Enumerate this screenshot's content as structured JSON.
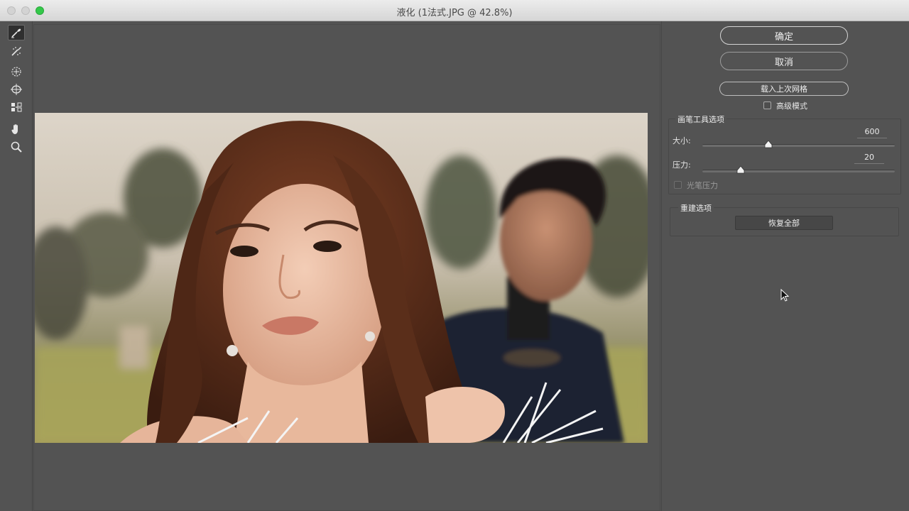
{
  "window": {
    "title": "液化 (1法式.JPG @ 42.8%)"
  },
  "toolbar": {
    "tools": [
      {
        "name": "forward-warp-tool",
        "icon": "warp-icon",
        "active": true
      },
      {
        "name": "reconstruct-tool",
        "icon": "reconstruct-brush-icon",
        "active": false
      },
      {
        "name": "pucker-tool",
        "icon": "pucker-icon",
        "active": false
      },
      {
        "name": "bloat-tool",
        "icon": "bloat-icon",
        "active": false
      },
      {
        "name": "push-left-tool",
        "icon": "push-left-icon",
        "active": false
      },
      {
        "name": "hand-tool",
        "icon": "hand-icon",
        "active": false
      },
      {
        "name": "zoom-tool",
        "icon": "zoom-icon",
        "active": false
      }
    ]
  },
  "panel": {
    "ok_label": "确定",
    "cancel_label": "取消",
    "load_mesh_label": "载入上次网格",
    "advanced_mode_label": "高级模式",
    "advanced_mode_checked": false,
    "brush_options": {
      "title": "画笔工具选项",
      "size_label": "大小:",
      "size_value": "600",
      "pressure_label": "压力:",
      "pressure_value": "20",
      "stylus_pressure_label": "光笔压力",
      "stylus_pressure_checked": false
    },
    "reconstruct_options": {
      "title": "重建选项",
      "restore_all_label": "恢复全部"
    }
  },
  "colors": {
    "background": "#535353",
    "titlebar": "#e3e3e3",
    "maximize_button": "#34c84a"
  }
}
